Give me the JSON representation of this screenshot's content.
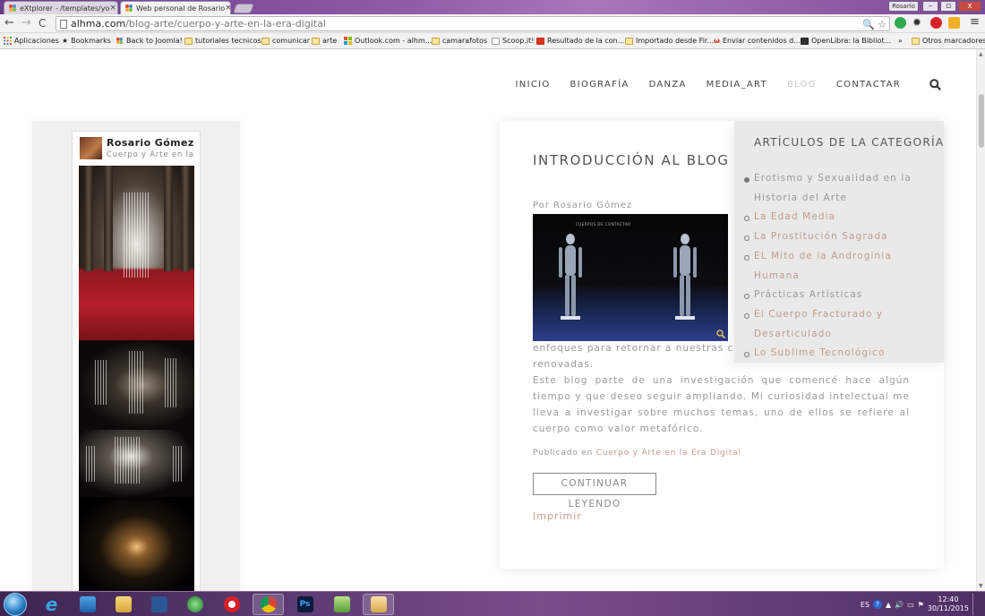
{
  "browser": {
    "tabs": [
      {
        "label": "eXtplorer - /templates/yo"
      },
      {
        "label": "Web personal de Rosario"
      }
    ],
    "profile_label": "Rosario",
    "window_controls": [
      "–",
      "▫",
      "x"
    ],
    "url_host": "alhma.com",
    "url_path": "/blog-arte/cuerpo-y-arte-en-la-era-digital",
    "bookmarks": [
      "Aplicaciones",
      "Bookmarks",
      "Back to Joomla!",
      "tutoriales tecnicos",
      "comunicar",
      "arte",
      "Outlook.com - alhm...",
      "camarafotos",
      "Scoop.it!",
      "Resultado de la con...",
      "Importado desde Fir...",
      "Enviar contenidos d...",
      "OpenLibra: la Bibliot..."
    ],
    "bookmarks_overflow": "»",
    "other_bookmarks": "Otros marcadores"
  },
  "site": {
    "nav": [
      "INICIO",
      "BIOGRAFÍA",
      "DANZA",
      "MEDIA_ART",
      "BLOG",
      "CONTACTAR"
    ],
    "active_nav": "BLOG"
  },
  "widget": {
    "name": "Rosario Gómez Ma...",
    "subtitle": "Cuerpo y Arte en la Era Digital"
  },
  "article": {
    "title": "INTRODUCCIÓN AL BLOG",
    "byline": "Por Rosario Gómez",
    "image_caption": "CUERPOS DE CONTACTAR",
    "text_line1": "enfoques para retornar a nuestras cue",
    "text_line2": "renovadas.",
    "paragraph": "Este blog parte de una investigación que comencé hace algún tiempo y que deseo seguir ampliando. Mi curiosidad intelectual me lleva a investigar sobre muchos temas, uno de ellos se refiere al cuerpo como valor metafórico.",
    "published_in_label": "Publicado en",
    "published_in_link": "Cuerpo y Arte en la Era Digital",
    "read_more": "CONTINUAR LEYENDO",
    "print": "Imprimir"
  },
  "categories": {
    "title": "ARTÍCULOS DE LA CATEGORÍA",
    "items": [
      "Erotismo y Sexualidad en la Historia del Arte",
      "La Edad Media",
      "La Prostitución Sagrada",
      "EL Mito de la Androginia Humana",
      "Prácticas Artísticas",
      "El Cuerpo Fracturado y Desarticulado",
      "Lo Sublime Tecnológico"
    ]
  },
  "taskbar": {
    "lang": "ES",
    "time": "12:40",
    "date": "30/11/2015"
  },
  "colors": {
    "accent_link": "#c39b8b",
    "body_text": "#999999",
    "panel_bg": "#e8e9e8"
  }
}
